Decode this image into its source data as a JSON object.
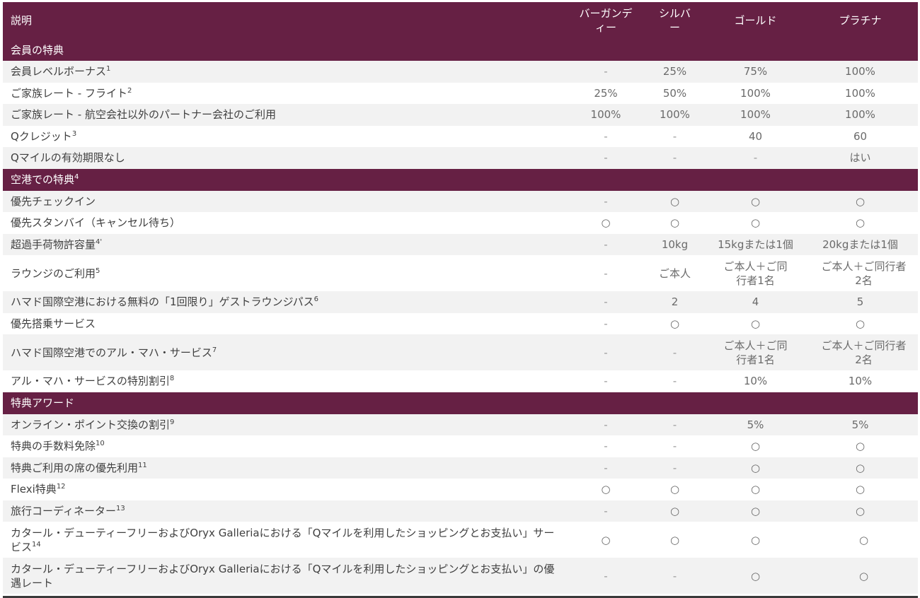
{
  "header": {
    "desc": "説明",
    "tiers": [
      "バーガンディー",
      "シルバー",
      "ゴールド",
      "プラチナ"
    ]
  },
  "sections": [
    {
      "title": "会員の特典",
      "sup": "",
      "rows": [
        {
          "label": "会員レベルボーナス",
          "sup": "1",
          "values": [
            "-",
            "25%",
            "75%",
            "100%"
          ]
        },
        {
          "label": "ご家族レート - フライト",
          "sup": "2",
          "values": [
            "25%",
            "50%",
            "100%",
            "100%"
          ]
        },
        {
          "label": "ご家族レート - 航空会社以外のパートナー会社のご利用",
          "sup": "",
          "values": [
            "100%",
            "100%",
            "100%",
            "100%"
          ]
        },
        {
          "label": "Qクレジット",
          "sup": "3",
          "values": [
            "-",
            "-",
            "40",
            "60"
          ]
        },
        {
          "label": "Qマイルの有効期限なし",
          "sup": "",
          "values": [
            "-",
            "-",
            "-",
            "はい"
          ]
        }
      ]
    },
    {
      "title": "空港での特典",
      "sup": "4",
      "rows": [
        {
          "label": "優先チェックイン",
          "sup": "",
          "values": [
            "-",
            "○",
            "○",
            "○"
          ]
        },
        {
          "label": "優先スタンバイ（キャンセル待ち）",
          "sup": "",
          "values": [
            "○",
            "○",
            "○",
            "○"
          ]
        },
        {
          "label": "超過手荷物許容量",
          "sup": "4'",
          "values": [
            "-",
            "10kg",
            "15kgまたは1個",
            "20kgまたは1個"
          ]
        },
        {
          "label": "ラウンジのご利用",
          "sup": "5",
          "values": [
            "-",
            "ご本人",
            "ご本人＋ご同行者1名",
            "ご本人＋ご同行者2名"
          ],
          "tall": true
        },
        {
          "label": "ハマド国際空港における無料の「1回限り」ゲストラウンジパス",
          "sup": "6",
          "values": [
            "-",
            "2",
            "4",
            "5"
          ]
        },
        {
          "label": "優先搭乗サービス",
          "sup": "",
          "values": [
            "-",
            "○",
            "○",
            "○"
          ]
        },
        {
          "label": "ハマド国際空港でのアル・マハ・サービス",
          "sup": "7",
          "values": [
            "-",
            "-",
            "ご本人＋ご同行者1名",
            "ご本人＋ご同行者2名"
          ],
          "tall": true
        },
        {
          "label": "アル・マハ・サービスの特別割引",
          "sup": "8",
          "values": [
            "-",
            "-",
            "10%",
            "10%"
          ]
        }
      ]
    },
    {
      "title": "特典アワード",
      "sup": "",
      "rows": [
        {
          "label": "オンライン・ポイント交換の割引",
          "sup": "9",
          "values": [
            "-",
            "-",
            "5%",
            "5%"
          ]
        },
        {
          "label": "特典の手数料免除",
          "sup": "10",
          "values": [
            "-",
            "-",
            "○",
            "○"
          ]
        },
        {
          "label": "特典ご利用の席の優先利用",
          "sup": "11",
          "values": [
            "-",
            "-",
            "○",
            "○"
          ]
        },
        {
          "label": "Flexi特典",
          "sup": "12",
          "values": [
            "○",
            "○",
            "○",
            "○"
          ]
        },
        {
          "label": "旅行コーディネーター",
          "sup": "13",
          "values": [
            "-",
            "○",
            "○",
            "○"
          ]
        },
        {
          "label": "カタール・デューティーフリーおよびOryx Galleriaにおける「Qマイルを利用したショッピングとお支払い」サービス",
          "sup": "14",
          "values": [
            "○",
            "○",
            "○",
            "○"
          ],
          "tall": true
        },
        {
          "label": "カタール・デューティーフリーおよびOryx Galleriaにおける「Qマイルを利用したショッピングとお支払い」の優遇レート",
          "sup": "",
          "values": [
            "-",
            "-",
            "○",
            "○"
          ],
          "tall": true
        }
      ]
    }
  ],
  "colors": {
    "header_bg": "#662044",
    "row_alt_bg": "#f2f2f2"
  }
}
